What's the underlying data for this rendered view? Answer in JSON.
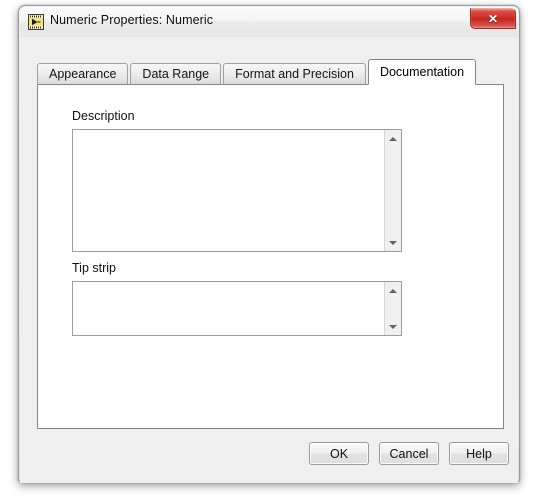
{
  "window": {
    "title": "Numeric Properties: Numeric",
    "icon": "labview-vi-icon",
    "close_label": "✕"
  },
  "tabs": [
    {
      "label": "Appearance",
      "active": false
    },
    {
      "label": "Data Range",
      "active": false
    },
    {
      "label": "Format and Precision",
      "active": false
    },
    {
      "label": "Documentation",
      "active": true
    }
  ],
  "panel": {
    "description": {
      "label": "Description",
      "value": "",
      "scrollbar": {
        "up_icon": "scroll-up-arrow-icon",
        "down_icon": "scroll-down-arrow-icon"
      }
    },
    "tip_strip": {
      "label": "Tip strip",
      "value": "",
      "scrollbar": {
        "up_icon": "scroll-up-arrow-icon",
        "down_icon": "scroll-down-arrow-icon"
      }
    }
  },
  "footer": {
    "ok_label": "OK",
    "cancel_label": "Cancel",
    "help_label": "Help"
  },
  "colors": {
    "close_button": "#c1231a",
    "dialog_background": "#efefef",
    "panel_background": "#ffffff",
    "border": "#848484"
  }
}
